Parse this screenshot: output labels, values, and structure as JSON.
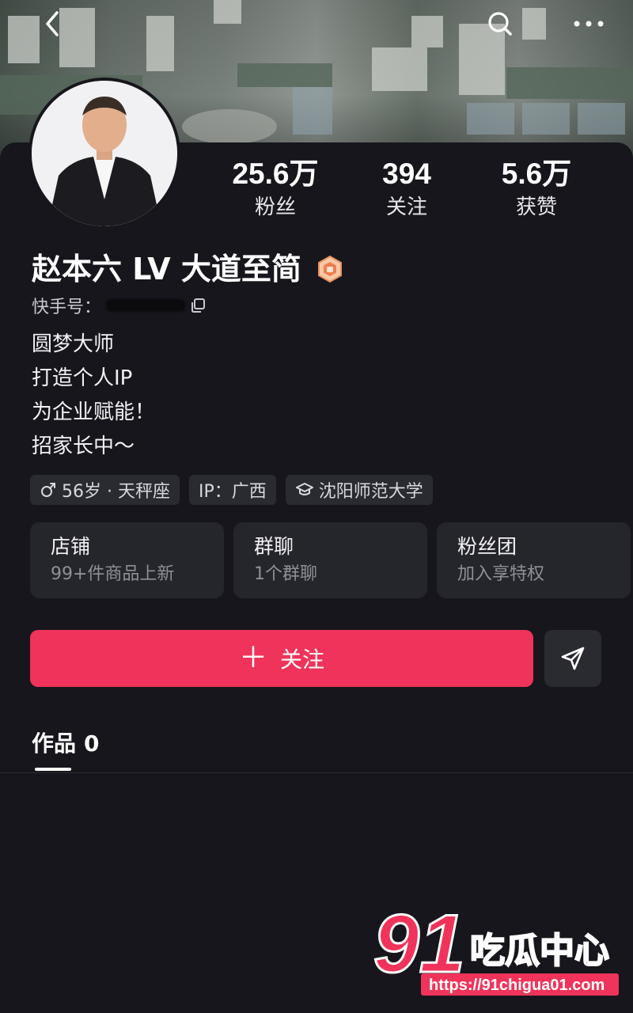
{
  "header": {
    "back_icon": "chevron-left-icon",
    "search_icon": "search-icon",
    "more_icon": "more-dots-icon"
  },
  "profile": {
    "name": "赵本六 LV 大道至简",
    "id_label": "快手号：",
    "stats": [
      {
        "value": "25.6万",
        "label": "粉丝"
      },
      {
        "value": "394",
        "label": "关注"
      },
      {
        "value": "5.6万",
        "label": "获赞"
      }
    ],
    "bio": [
      "圆梦大师",
      "打造个人IP",
      "为企业赋能！",
      "招家长中～"
    ],
    "tags": {
      "age_zodiac": "56岁 · 天秤座",
      "ip": "IP：广西",
      "school": "沈阳师范大学"
    }
  },
  "cards": [
    {
      "title": "店铺",
      "subtitle": "99+件商品上新"
    },
    {
      "title": "群聊",
      "subtitle": "1个群聊"
    },
    {
      "title": "粉丝团",
      "subtitle": "加入享特权"
    }
  ],
  "actions": {
    "follow_plus": "＋",
    "follow_label": "关注"
  },
  "tabs": {
    "works_label": "作品",
    "works_count": "0"
  },
  "watermark": {
    "brand_number": "91",
    "brand_text": "吃瓜中心",
    "url": "https://91chigua01.com"
  },
  "colors": {
    "background": "#17161c",
    "accent_follow": "#f0335a",
    "card_bg": "#25252c"
  }
}
